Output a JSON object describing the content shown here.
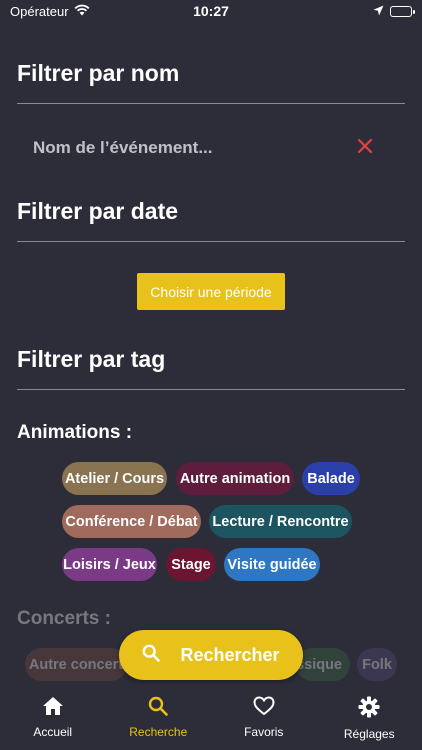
{
  "status_bar": {
    "carrier": "Opérateur",
    "time": "10:27"
  },
  "name_filter": {
    "title": "Filtrer par nom",
    "placeholder": "Nom de l’événement..."
  },
  "date_filter": {
    "title": "Filtrer par date",
    "button_label": "Choisir une période"
  },
  "tag_filter": {
    "title": "Filtrer par tag",
    "animations": {
      "label": "Animations :",
      "tags": [
        {
          "label": "Atelier / Cours",
          "color": "#8a7350"
        },
        {
          "label": "Autre animation",
          "color": "#5e1d3d"
        },
        {
          "label": "Balade",
          "color": "#2b3fa8"
        },
        {
          "label": "Conférence / Débat",
          "color": "#a06a5c"
        },
        {
          "label": "Lecture / Rencontre",
          "color": "#1c5560"
        },
        {
          "label": "Loisirs / Jeux",
          "color": "#7a3a86"
        },
        {
          "label": "Stage",
          "color": "#6b1530"
        },
        {
          "label": "Visite guidée",
          "color": "#2f77c2"
        }
      ]
    },
    "concerts": {
      "label": "Concerts :",
      "tags": [
        {
          "label": "Autre concert",
          "color": "#7a4a3a"
        },
        {
          "label": "ssique",
          "color": "#3a6a3a"
        },
        {
          "label": "Folk",
          "color": "#5a4a7a"
        }
      ]
    }
  },
  "search_button": {
    "label": "Rechercher"
  },
  "tab_bar": {
    "tabs": [
      {
        "label": "Accueil",
        "icon": "home-icon"
      },
      {
        "label": "Recherche",
        "icon": "search-icon",
        "active": true
      },
      {
        "label": "Favoris",
        "icon": "heart-icon"
      },
      {
        "label": "Réglages",
        "icon": "gear-icon"
      }
    ]
  },
  "colors": {
    "background": "#2d2d3a",
    "accent": "#e8c21b",
    "clear": "#e84040"
  }
}
